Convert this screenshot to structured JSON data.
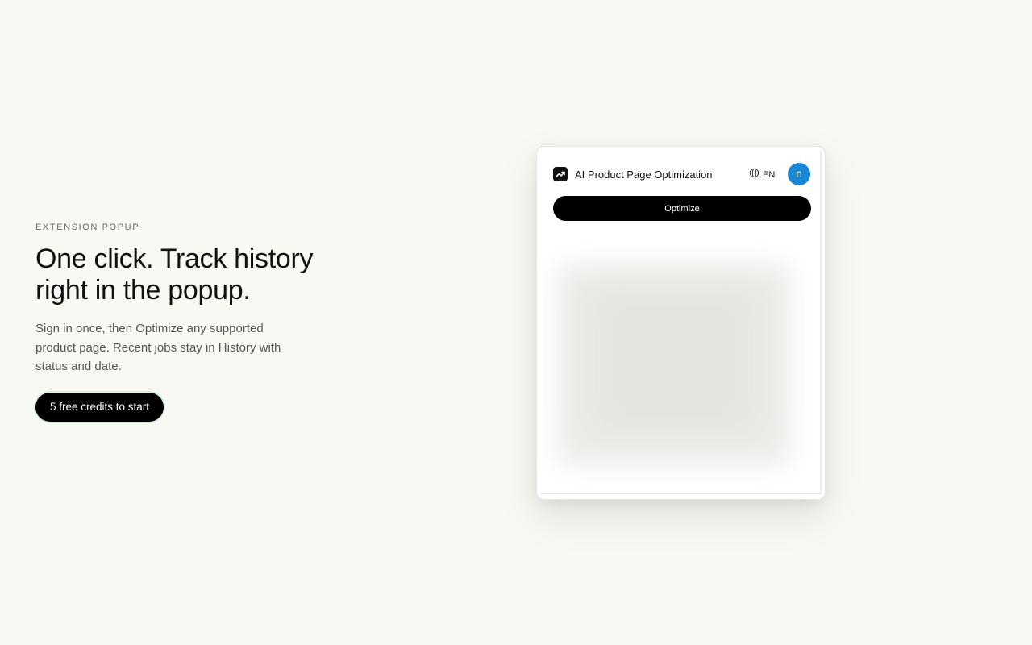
{
  "hero": {
    "eyebrow": "EXTENSION POPUP",
    "headline_line1": "One click. Track history",
    "headline_line2": "right in the popup.",
    "description": "Sign in once, then Optimize any supported product page. Recent jobs stay in History with status and date.",
    "cta_label": "5 free credits to start"
  },
  "popup": {
    "logo_icon": "trending-up-icon",
    "title": "AI Product Page Optimization",
    "language_icon": "globe-icon",
    "language": "EN",
    "avatar_initial": "n",
    "optimize_label": "Optimize"
  },
  "colors": {
    "background": "#f9f9f4",
    "primary": "#000000",
    "avatar": "#1a86d6",
    "cta_ring": "#d6f0dd"
  }
}
